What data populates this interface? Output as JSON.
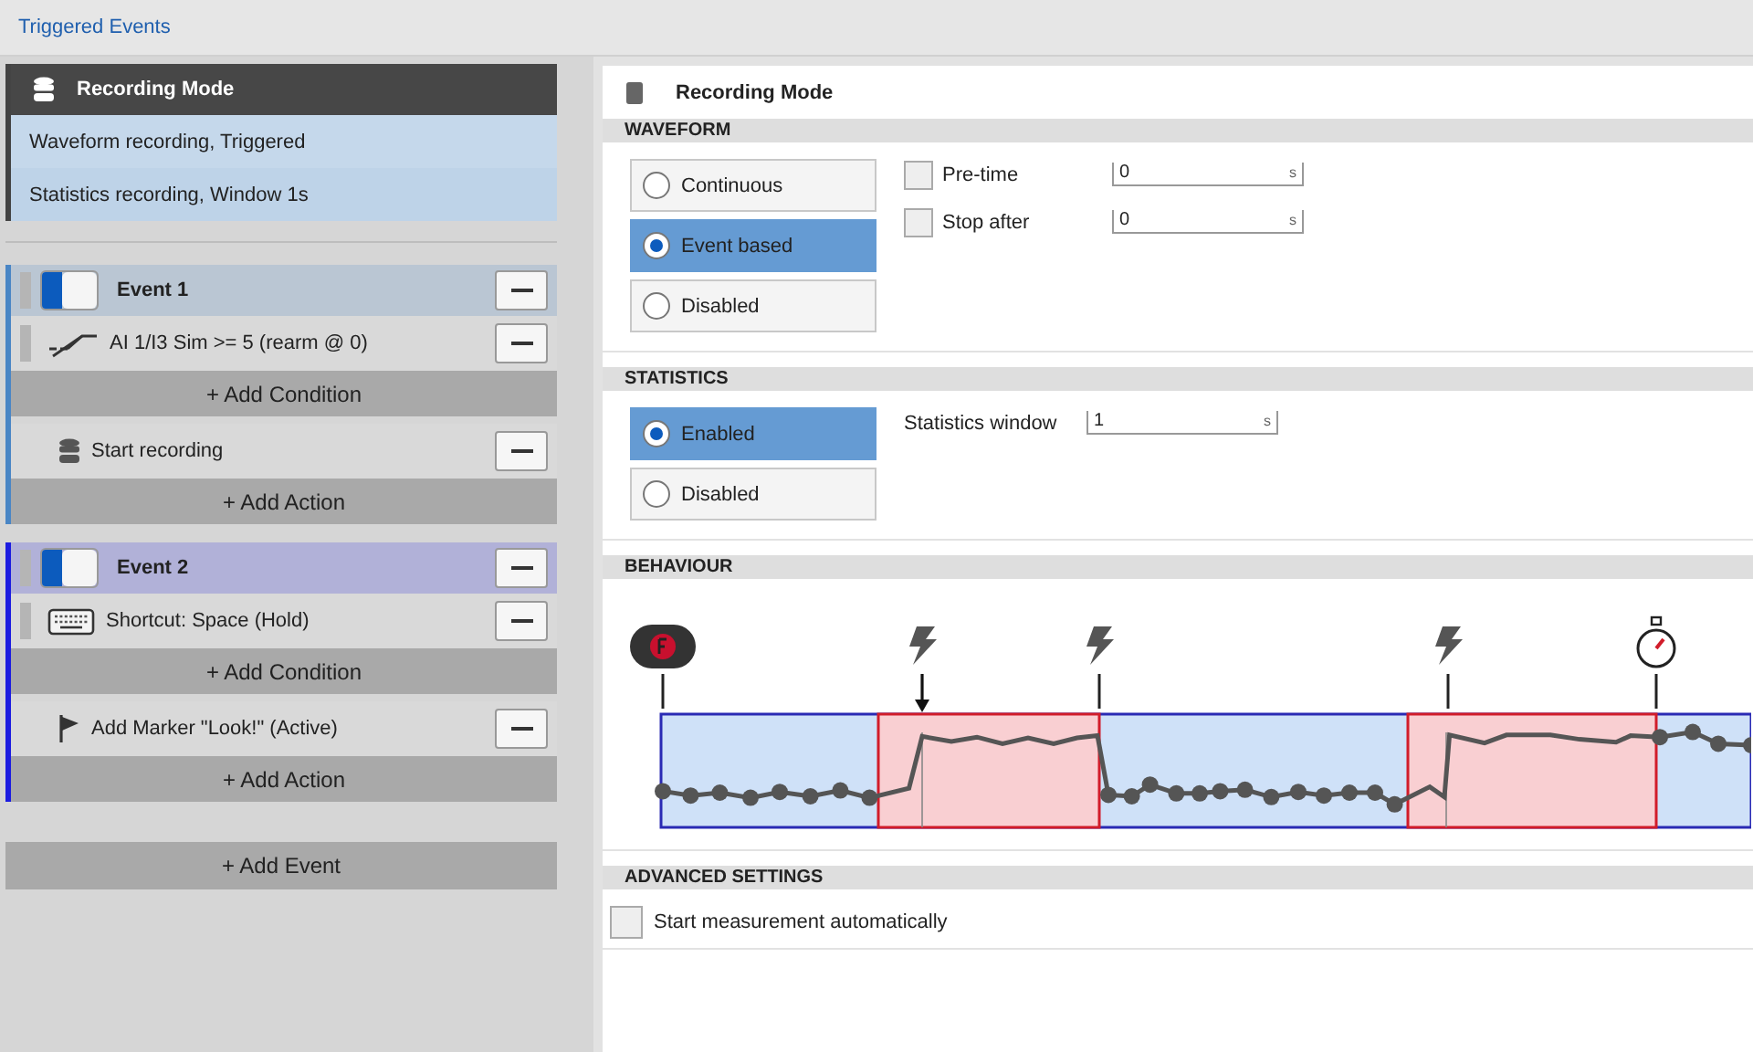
{
  "title": "Triggered Events",
  "recording_mode": {
    "title": "Recording Mode",
    "lines": [
      "Waveform recording, Triggered",
      "Statistics recording, Window 1s"
    ]
  },
  "events": [
    {
      "title": "Event 1",
      "on": true,
      "color": "#4a86c5",
      "conditions": [
        {
          "kind": "threshold",
          "label": "AI 1/I3 Sim >= 5 (rearm @ 0)"
        }
      ],
      "add_condition": "+ Add Condition",
      "actions": [
        {
          "kind": "record",
          "label": "Start recording"
        }
      ],
      "add_action": "+ Add Action"
    },
    {
      "title": "Event 2",
      "on": true,
      "color": "#1c1ce0",
      "conditions": [
        {
          "kind": "shortcut",
          "label": "Shortcut: Space (Hold)"
        }
      ],
      "add_condition": "+ Add Condition",
      "actions": [
        {
          "kind": "marker",
          "label": "Add Marker \"Look!\" (Active)"
        }
      ],
      "add_action": "+ Add Action"
    }
  ],
  "add_event": "+ Add Event",
  "panel": {
    "title": "Recording Mode",
    "sections": [
      {
        "kind": "options",
        "title": "WAVEFORM",
        "options": [
          {
            "label": "Continuous",
            "selected": false
          },
          {
            "label": "Event based",
            "selected": true
          },
          {
            "label": "Disabled",
            "selected": false
          }
        ],
        "fields": [
          {
            "kind": "check_field",
            "label": "Pre-time",
            "checked": false,
            "value": "0",
            "unit": "s"
          },
          {
            "kind": "check_field",
            "label": "Stop after",
            "checked": false,
            "value": "0",
            "unit": "s"
          }
        ]
      },
      {
        "kind": "options",
        "title": "STATISTICS",
        "options": [
          {
            "label": "Enabled",
            "selected": true
          },
          {
            "label": "Disabled",
            "selected": false
          }
        ],
        "fields": [
          {
            "kind": "field",
            "label": "Statistics window",
            "value": "1",
            "unit": "s"
          }
        ]
      },
      {
        "kind": "behaviour",
        "title": "BEHAVIOUR"
      },
      {
        "kind": "checks",
        "title": "ADVANCED SETTINGS",
        "checkboxes": [
          {
            "label": "Start measurement automatically",
            "checked": false
          }
        ]
      }
    ]
  }
}
